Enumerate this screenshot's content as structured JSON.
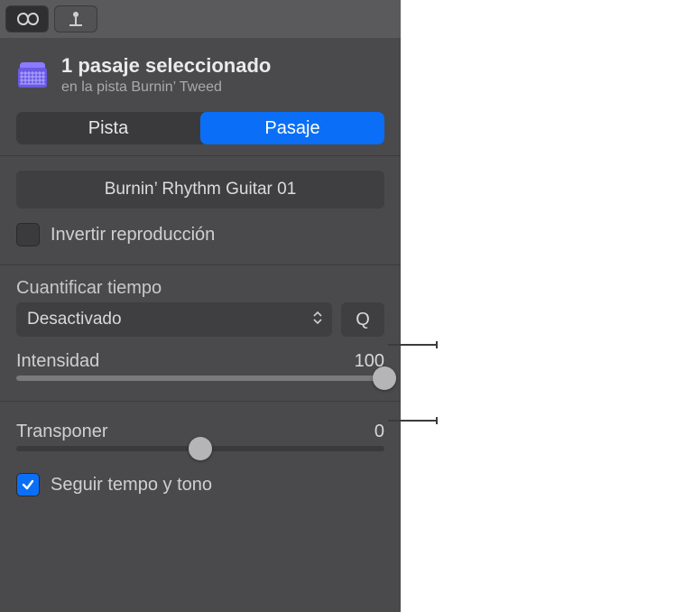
{
  "header": {
    "title": "1 pasaje seleccionado",
    "subtitle": "en la pista Burnin’ Tweed"
  },
  "segmented": {
    "track": "Pista",
    "region": "Pasaje"
  },
  "region_name": "Burnin’ Rhythm Guitar 01",
  "reverse": {
    "label": "Invertir reproducción",
    "checked": false
  },
  "quantize": {
    "label": "Cuantificar tiempo",
    "value": "Desactivado",
    "q_button": "Q"
  },
  "strength": {
    "label": "Intensidad",
    "value": "100",
    "pct": 100
  },
  "transpose": {
    "label": "Transponer",
    "value": "0",
    "pct": 50
  },
  "follow": {
    "label": "Seguir tempo y tono",
    "checked": true
  }
}
